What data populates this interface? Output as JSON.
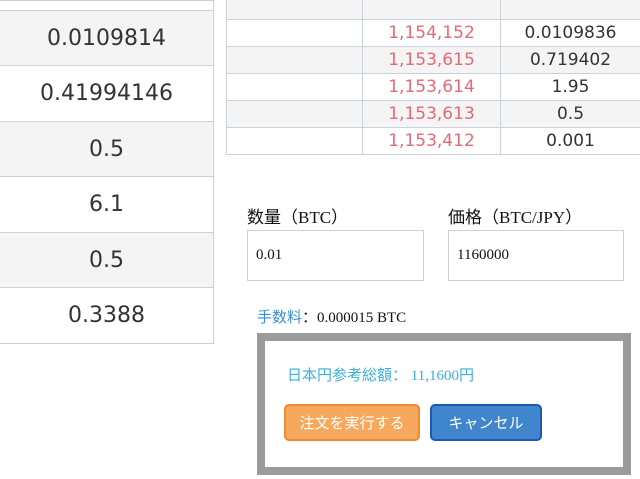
{
  "left_amounts": [
    "0.0109814",
    "0.41994146",
    "0.5",
    "6.1",
    "0.5",
    "0.3388"
  ],
  "order_book": [
    {
      "price": "",
      "amount": ""
    },
    {
      "price": "1,154,152",
      "amount": "0.0109836"
    },
    {
      "price": "1,153,615",
      "amount": "0.719402"
    },
    {
      "price": "1,153,614",
      "amount": "1.95"
    },
    {
      "price": "1,153,613",
      "amount": "0.5"
    },
    {
      "price": "1,153,412",
      "amount": "0.001"
    }
  ],
  "form": {
    "quantity_label": "数量（BTC）",
    "quantity_value": "0.01",
    "price_label": "価格（BTC/JPY）",
    "price_value": "1160000",
    "fee_label": "手数料",
    "fee_value": "：0.000015 BTC"
  },
  "confirm": {
    "total_label": "日本円参考総額：",
    "total_value": "11,1600円",
    "execute_label": "注文を実行する",
    "cancel_label": "キャンセル"
  },
  "colors": {
    "ask_price": "#e36a75",
    "fee_label": "#3c8ecb",
    "total_text": "#3ab0db",
    "execute_button": "#f6a85c",
    "cancel_button": "#3f86cc",
    "confirm_border": "#9b9b9b"
  }
}
